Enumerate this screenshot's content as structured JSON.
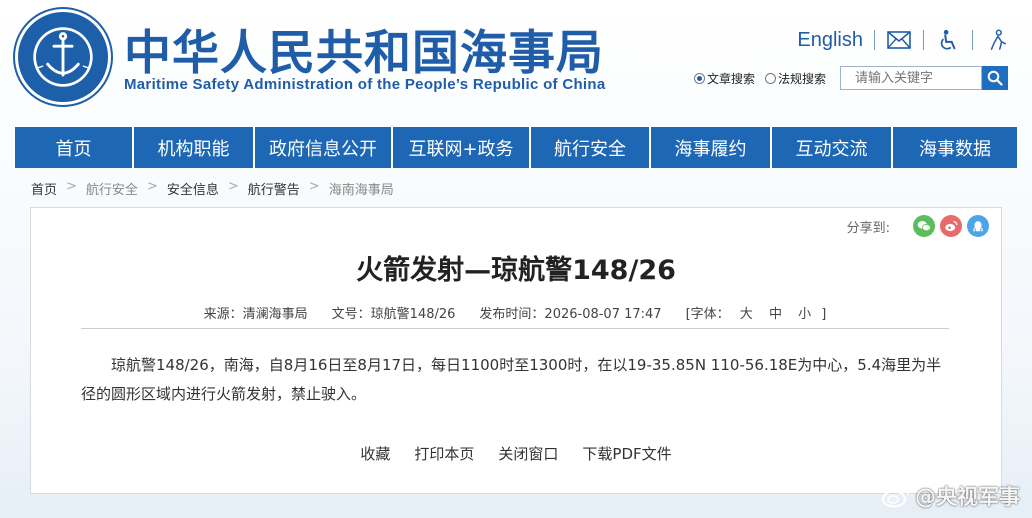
{
  "header": {
    "title_cn": "中华人民共和国海事局",
    "title_en": "Maritime Safety Administration of the People’s Republic of China",
    "logo_text_top": "中国海事局",
    "logo_text_bottom": "CHINA MSA",
    "english_link": "English",
    "icons": [
      "mail-icon",
      "accessibility-icon",
      "elder-care-icon"
    ],
    "search": {
      "options": [
        {
          "label": "文章搜索",
          "selected": true
        },
        {
          "label": "法规搜索",
          "selected": false
        }
      ],
      "placeholder": "请输入关键字"
    }
  },
  "nav": {
    "items": [
      {
        "label": "首页"
      },
      {
        "label": "机构职能"
      },
      {
        "label": "政府信息公开"
      },
      {
        "label": "互联网+政务"
      },
      {
        "label": "航行安全"
      },
      {
        "label": "海事履约"
      },
      {
        "label": "互动交流"
      },
      {
        "label": "海事数据"
      }
    ]
  },
  "breadcrumb": [
    "首页",
    "航行安全",
    "安全信息",
    "航行警告",
    "海南海事局"
  ],
  "article": {
    "share_label": "分享到:",
    "title": "火箭发射—琼航警148/26",
    "source": "来源：清澜海事局",
    "doc_no": "文号：琼航警148/26",
    "publish_time": "发布时间：2026-08-07 17:47",
    "font_label": "[字体：",
    "font_sizes": [
      "大",
      "中",
      "小"
    ],
    "font_close": "]",
    "body": "琼航警148/26，南海，自8月16日至8月17日，每日1100时至1300时，在以19-35.85N 110-56.18E为中心，5.4海里为半径的圆形区域内进行火箭发射，禁止驶入。",
    "actions": [
      "收藏",
      "打印本页",
      "关闭窗口",
      "下载PDF文件"
    ]
  },
  "watermark": "@央视军事",
  "colors": {
    "brand_blue": "#1f5da8",
    "nav_blue": "#1d67b4",
    "wechat_green": "#5bbd5b",
    "weibo_red": "#e86a6a",
    "qq_blue": "#4aa6e8"
  }
}
